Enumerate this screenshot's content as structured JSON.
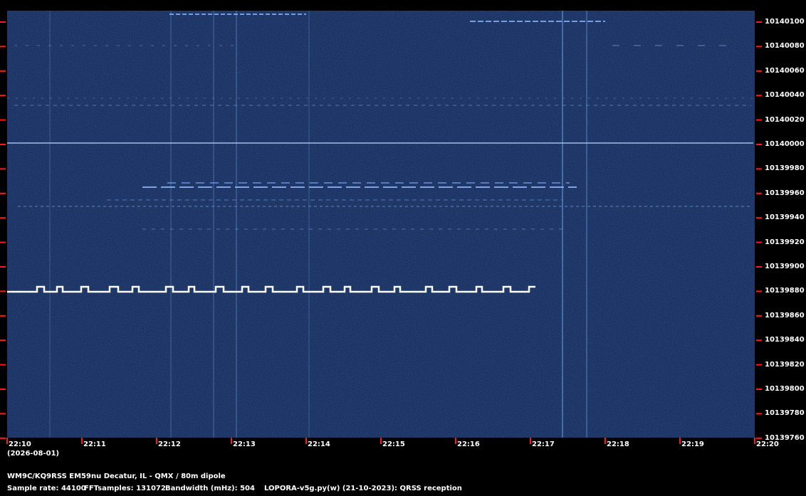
{
  "colors": {
    "background": "#0c1f4d",
    "tick_red": "#ff1a1a",
    "signal": "#ffffff",
    "trace": "#8fb6ff"
  },
  "plot": {
    "y_tick_labels": [
      "10140100",
      "10140080",
      "10140060",
      "10140040",
      "10140020",
      "10140000",
      "10139980",
      "10139960",
      "10139940",
      "10139920",
      "10139900",
      "10139880",
      "10139860",
      "10139840",
      "10139820",
      "10139800",
      "10139780",
      "10139760"
    ],
    "x_tick_labels": [
      "22:10",
      "22:11",
      "22:12",
      "22:13",
      "22:14",
      "22:15",
      "22:16",
      "22:17",
      "22:18",
      "22:19",
      "22:20"
    ],
    "date": "(2026-08-01)"
  },
  "footer": {
    "station": "WM9C/KQ9RSS EM59nu Decatur, IL - QMX / 80m dipole",
    "sample_rate": "Sample rate: 44100",
    "fft": "FFTsamples: 131072",
    "bandwidth": "Bandwidth (mHz): 504",
    "software": "LOPORA-v5g.py(w) (21-10-2023): QRSS reception"
  }
}
